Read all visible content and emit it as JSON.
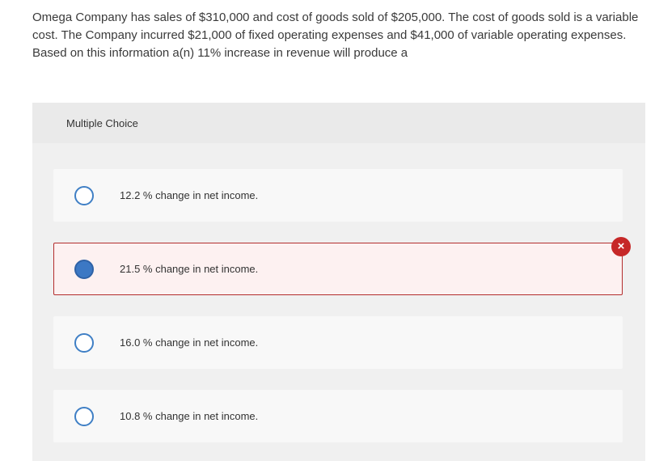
{
  "question": {
    "text": "Omega Company has sales of $310,000 and cost of goods sold of $205,000. The cost of goods sold is a variable cost. The Company incurred $21,000 of fixed operating expenses and $41,000 of variable operating expenses. Based on this information a(n) 11% increase in revenue will produce a"
  },
  "multiple_choice": {
    "title": "Multiple Choice",
    "options": [
      {
        "label": "12.2 % change in net income.",
        "selected": false
      },
      {
        "label": "21.5 % change in net income.",
        "selected": true,
        "status": "incorrect"
      },
      {
        "label": "16.0 % change in net income.",
        "selected": false
      },
      {
        "label": "10.8 % change in net income.",
        "selected": false
      }
    ]
  },
  "icons": {
    "incorrect_mark": "×",
    "incorrect_icon_name": "incorrect-x-icon"
  },
  "colors": {
    "radio_blue": "#3c78c4",
    "incorrect_red": "#c62828",
    "incorrect_bg": "#fdf1f1"
  }
}
